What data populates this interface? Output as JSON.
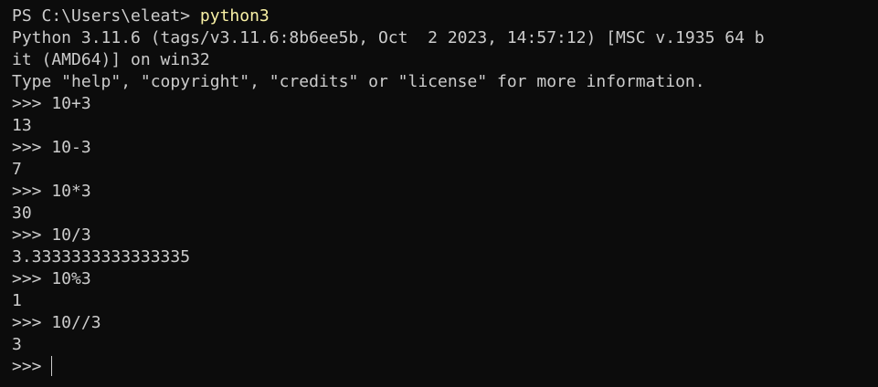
{
  "terminal": {
    "prompt_line": {
      "prompt": "PS C:\\Users\\eleat> ",
      "command": "python3"
    },
    "banner": [
      "Python 3.11.6 (tags/v3.11.6:8b6ee5b, Oct  2 2023, 14:57:12) [MSC v.1935 64 b",
      "it (AMD64)] on win32",
      "Type \"help\", \"copyright\", \"credits\" or \"license\" for more information."
    ],
    "session": [
      {
        "input": ">>> 10+3",
        "output": "13"
      },
      {
        "input": ">>> 10-3",
        "output": "7"
      },
      {
        "input": ">>> 10*3",
        "output": "30"
      },
      {
        "input": ">>> 10/3",
        "output": "3.3333333333333335"
      },
      {
        "input": ">>> 10%3",
        "output": "1"
      },
      {
        "input": ">>> 10//3",
        "output": "3"
      }
    ],
    "current_prompt": ">>> "
  },
  "colors": {
    "background": "#0c0c0c",
    "text": "#cccccc",
    "command": "#f9f1a5"
  }
}
